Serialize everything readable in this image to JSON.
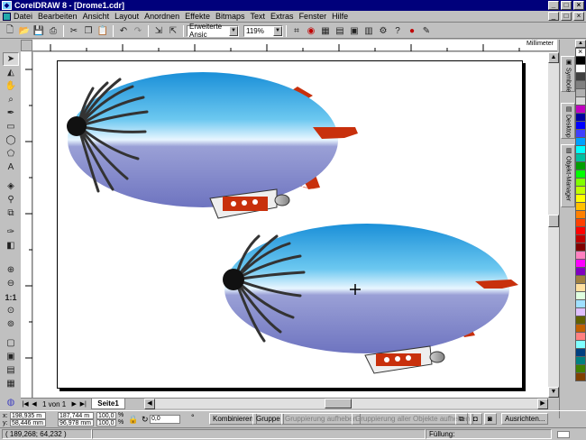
{
  "window": {
    "title": "CorelDRAW 8 - [Drome1.cdr]",
    "min": "_",
    "max": "□",
    "close": "×"
  },
  "menu": [
    "Datei",
    "Bearbeiten",
    "Ansicht",
    "Layout",
    "Anordnen",
    "Effekte",
    "Bitmaps",
    "Text",
    "Extras",
    "Fenster",
    "Hilfe"
  ],
  "toolbar": {
    "view_mode": "Erweiterte Ansic",
    "zoom": "119%"
  },
  "ruler": {
    "units": "Millimeter"
  },
  "dockers": [
    "Symbole",
    "Desktop",
    "Objekt-Manager"
  ],
  "pages": {
    "position": "1 von 1",
    "tab": "Seite1"
  },
  "props": {
    "x_label": "x:",
    "x": "198,935 m",
    "y_label": "y:",
    "y": "58,446 mm",
    "w": "187,744 m",
    "h": "96,978 mm",
    "sx": "100,0",
    "sy": "100,0",
    "pct": "%",
    "angle": "0,0",
    "deg": "°",
    "combine": "Kombinieren",
    "group": "Gruppe",
    "ungroup": "Gruppierung aufheben",
    "ungroup_all": "Gruppierung aller Objekte aufheben",
    "align": "Ausrichten..."
  },
  "status": {
    "coords": "( 189,268; 64,232 )",
    "fill_label": "Füllung:"
  },
  "colors": {
    "title_bg": "#00007b",
    "ui_bg": "#c0c0c0",
    "blimp_top": "#2aa8e0",
    "blimp_bottom": "#8086c8",
    "fin": "#c8300c"
  },
  "palette": [
    "#000000",
    "#ffffff",
    "#404040",
    "#808080",
    "#b0b0b0",
    "#d8d8d8",
    "#c000c0",
    "#0000a0",
    "#0000ff",
    "#4040ff",
    "#00a0ff",
    "#00ffff",
    "#00c0a0",
    "#00a000",
    "#00ff00",
    "#80ff00",
    "#c0ff00",
    "#ffff00",
    "#ffc000",
    "#ff8000",
    "#ff4000",
    "#ff0000",
    "#c00000",
    "#800000",
    "#ff80c0",
    "#ff00ff",
    "#8000c0",
    "#a08040",
    "#ffe0a0",
    "#e0ffe0",
    "#a0e0ff",
    "#e0c0ff",
    "#606000",
    "#c06000",
    "#ff8080",
    "#80ffff",
    "#004080",
    "#008080",
    "#408000",
    "#804000"
  ]
}
